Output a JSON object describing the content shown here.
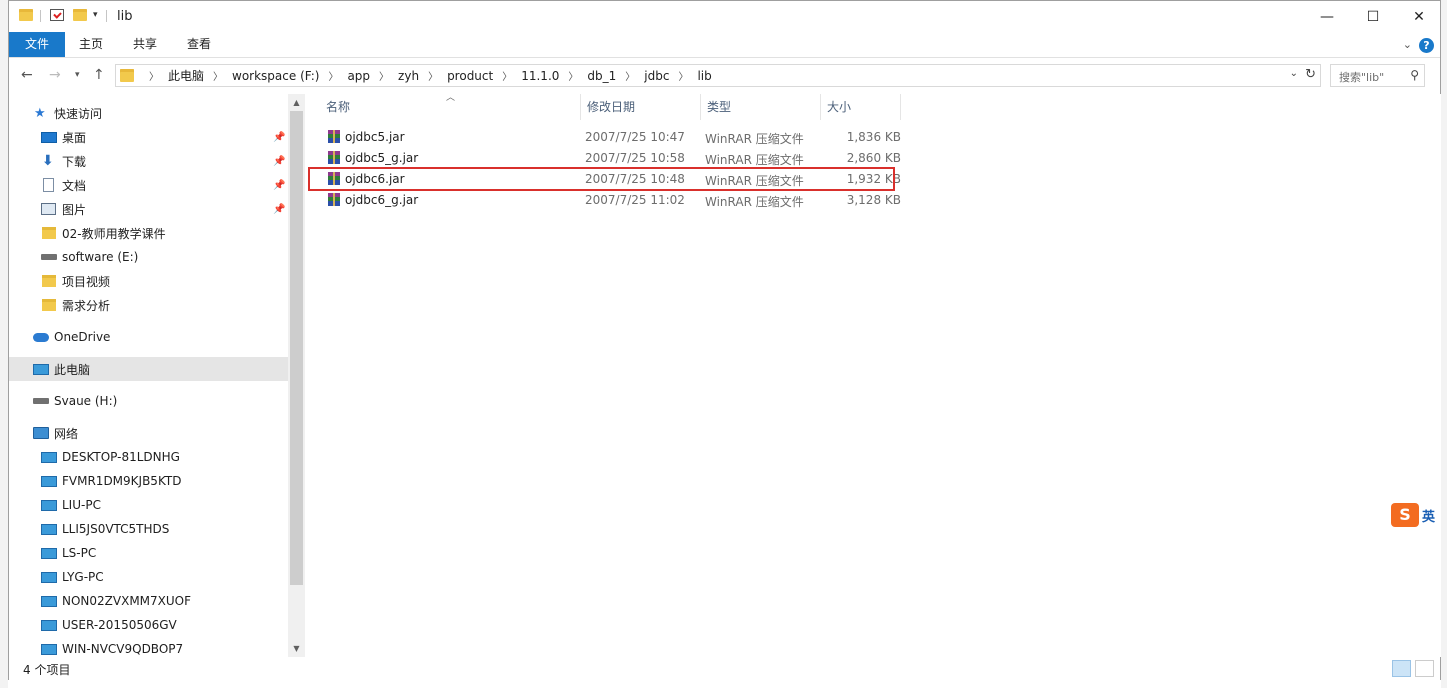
{
  "window": {
    "title": "lib",
    "controls": {
      "minimize": "—",
      "maximize": "☐",
      "close": "✕"
    }
  },
  "ribbon": {
    "tabs": [
      "文件",
      "主页",
      "共享",
      "查看"
    ],
    "expand": "⌄",
    "help": "?"
  },
  "address": {
    "crumbs": [
      "此电脑",
      "workspace (F:)",
      "app",
      "zyh",
      "product",
      "11.1.0",
      "db_1",
      "jdbc",
      "lib"
    ],
    "search_placeholder": "搜索\"lib\""
  },
  "nav": {
    "quick_access": "快速访问",
    "quick_items": [
      "桌面",
      "下载",
      "文档",
      "图片"
    ],
    "folders": [
      "02-教师用教学课件",
      "software (E:)",
      "项目视频",
      "需求分析"
    ],
    "onedrive": "OneDrive",
    "this_pc": "此电脑",
    "drive_h": "Svaue (H:)",
    "network": "网络",
    "computers": [
      "DESKTOP-81LDNHG",
      "FVMR1DM9KJB5KTD",
      "LIU-PC",
      "LLI5JS0VTC5THDS",
      "LS-PC",
      "LYG-PC",
      "NON02ZVXMM7XUOF",
      "USER-20150506GV",
      "WIN-NVCV9QDBOP7"
    ]
  },
  "columns": {
    "name": "名称",
    "date": "修改日期",
    "type": "类型",
    "size": "大小"
  },
  "files": [
    {
      "name": "ojdbc5.jar",
      "date": "2007/7/25 10:47",
      "type": "WinRAR 压缩文件",
      "size": "1,836 KB"
    },
    {
      "name": "ojdbc5_g.jar",
      "date": "2007/7/25 10:58",
      "type": "WinRAR 压缩文件",
      "size": "2,860 KB"
    },
    {
      "name": "ojdbc6.jar",
      "date": "2007/7/25 10:48",
      "type": "WinRAR 压缩文件",
      "size": "1,932 KB"
    },
    {
      "name": "ojdbc6_g.jar",
      "date": "2007/7/25 11:02",
      "type": "WinRAR 压缩文件",
      "size": "3,128 KB"
    }
  ],
  "status": {
    "count": "4 个项目"
  },
  "ime": {
    "logo": "S",
    "mode": "英"
  },
  "colors": {
    "accent": "#1979ca",
    "highlight_border": "#d9302c",
    "selected_bg": "#e5e5e5"
  }
}
